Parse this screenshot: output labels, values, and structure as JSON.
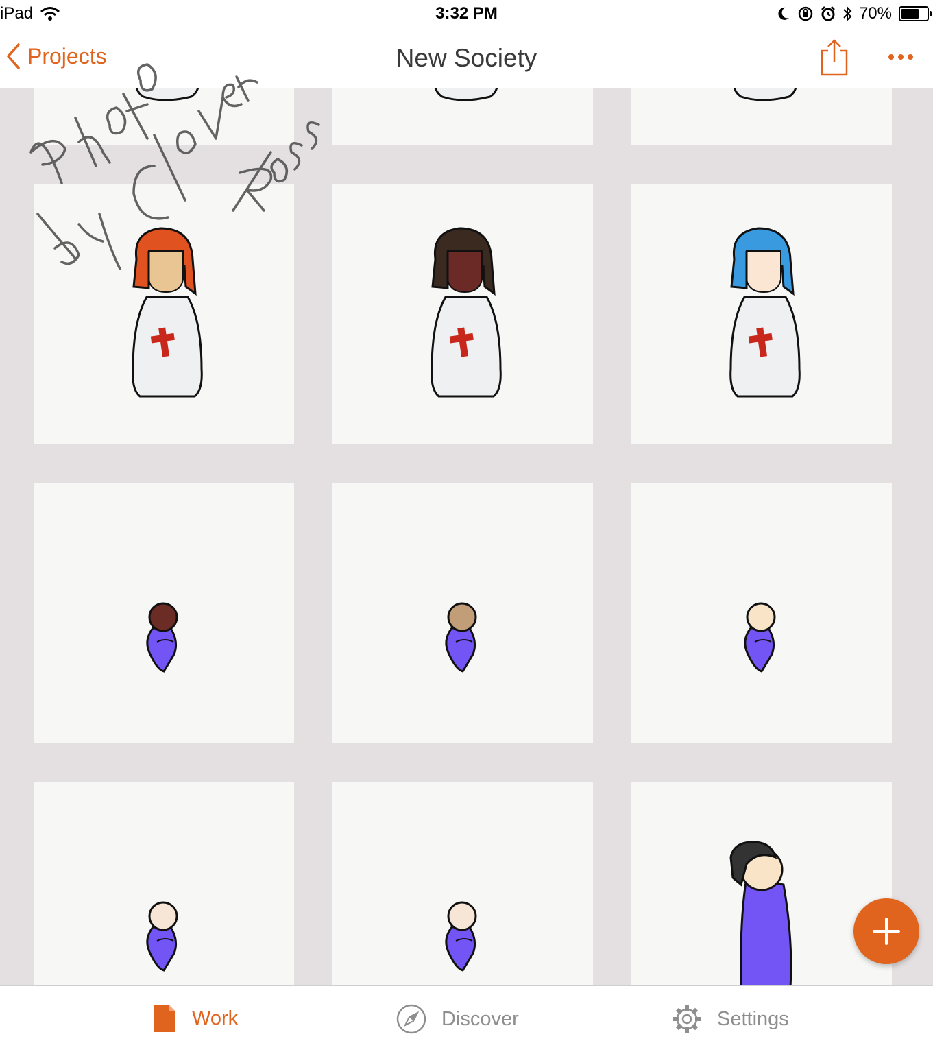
{
  "status_bar": {
    "device": "iPad",
    "time": "3:32 PM",
    "battery": "70%",
    "battery_level": 0.7,
    "icons": [
      "wifi-icon",
      "moon-icon",
      "orientation-lock-icon",
      "alarm-icon",
      "bluetooth-icon",
      "battery-icon"
    ]
  },
  "nav": {
    "back_label": "Projects",
    "title": "New Society",
    "actions": [
      "share-icon",
      "more-icon"
    ]
  },
  "watermark": {
    "text": "Photo by Clover Ross"
  },
  "grid": {
    "columns": 3,
    "tiles": [
      {
        "figure": "robe-partial",
        "robe": "#eef0f1"
      },
      {
        "figure": "robe-partial",
        "robe": "#eef0f1"
      },
      {
        "figure": "robe-partial",
        "robe": "#eef0f1"
      },
      {
        "figure": "priestess",
        "hair": "#e0521f",
        "skin": "#e9c594",
        "robe": "#eef0f1",
        "cross": "#c8281b"
      },
      {
        "figure": "priestess",
        "hair": "#3a2a20",
        "skin": "#6b2a26",
        "robe": "#eef0f1",
        "cross": "#c8281b"
      },
      {
        "figure": "priestess",
        "hair": "#3a9ae0",
        "skin": "#fbe6d3",
        "robe": "#eef0f1",
        "cross": "#c8281b"
      },
      {
        "figure": "baby",
        "skin": "#6a2c24",
        "wrap": "#7255f4"
      },
      {
        "figure": "baby",
        "skin": "#c19d78",
        "wrap": "#7255f4"
      },
      {
        "figure": "baby",
        "skin": "#fae4c8",
        "wrap": "#7255f4"
      },
      {
        "figure": "baby",
        "skin": "#f7e6d6",
        "wrap": "#7255f4"
      },
      {
        "figure": "baby",
        "skin": "#f7e6d6",
        "wrap": "#7255f4"
      },
      {
        "figure": "adult",
        "hair": "#333333",
        "skin": "#fae4c8",
        "robe": "#7255f4"
      }
    ]
  },
  "fab": {
    "icon": "plus-icon",
    "color": "#e0641d"
  },
  "tabs": [
    {
      "label": "Work",
      "icon": "document-icon",
      "active": true
    },
    {
      "label": "Discover",
      "icon": "compass-icon",
      "active": false
    },
    {
      "label": "Settings",
      "icon": "gear-icon",
      "active": false
    }
  ],
  "colors": {
    "accent": "#e0641d",
    "grid_bg": "#e4e0e1",
    "tile_bg": "#f7f7f6"
  }
}
